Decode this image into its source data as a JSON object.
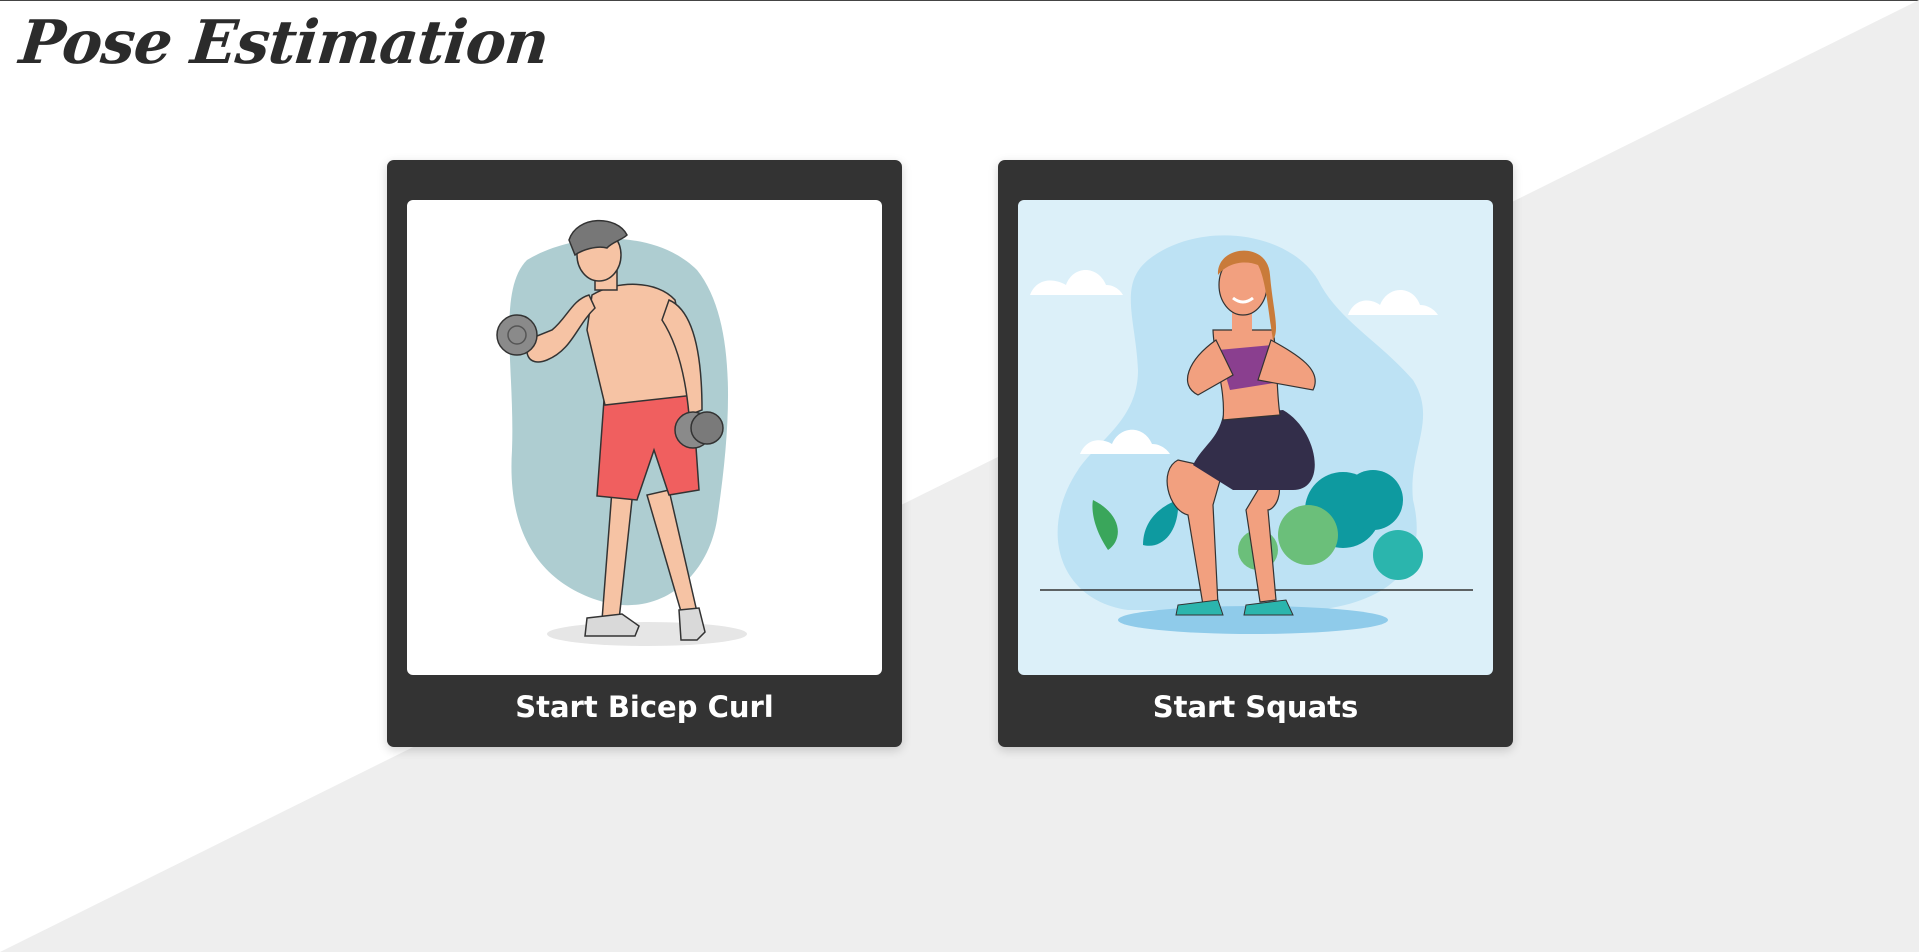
{
  "page": {
    "title": "Pose Estimation"
  },
  "cards": [
    {
      "label": "Start Bicep Curl",
      "illustration": "man-bicep-curl-illustration"
    },
    {
      "label": "Start Squats",
      "illustration": "woman-squat-illustration"
    }
  ],
  "colors": {
    "card_bg": "#333333",
    "page_bg": "#ffffff",
    "diagonal_bg": "#eeeeee",
    "title": "#2b2b2b"
  }
}
